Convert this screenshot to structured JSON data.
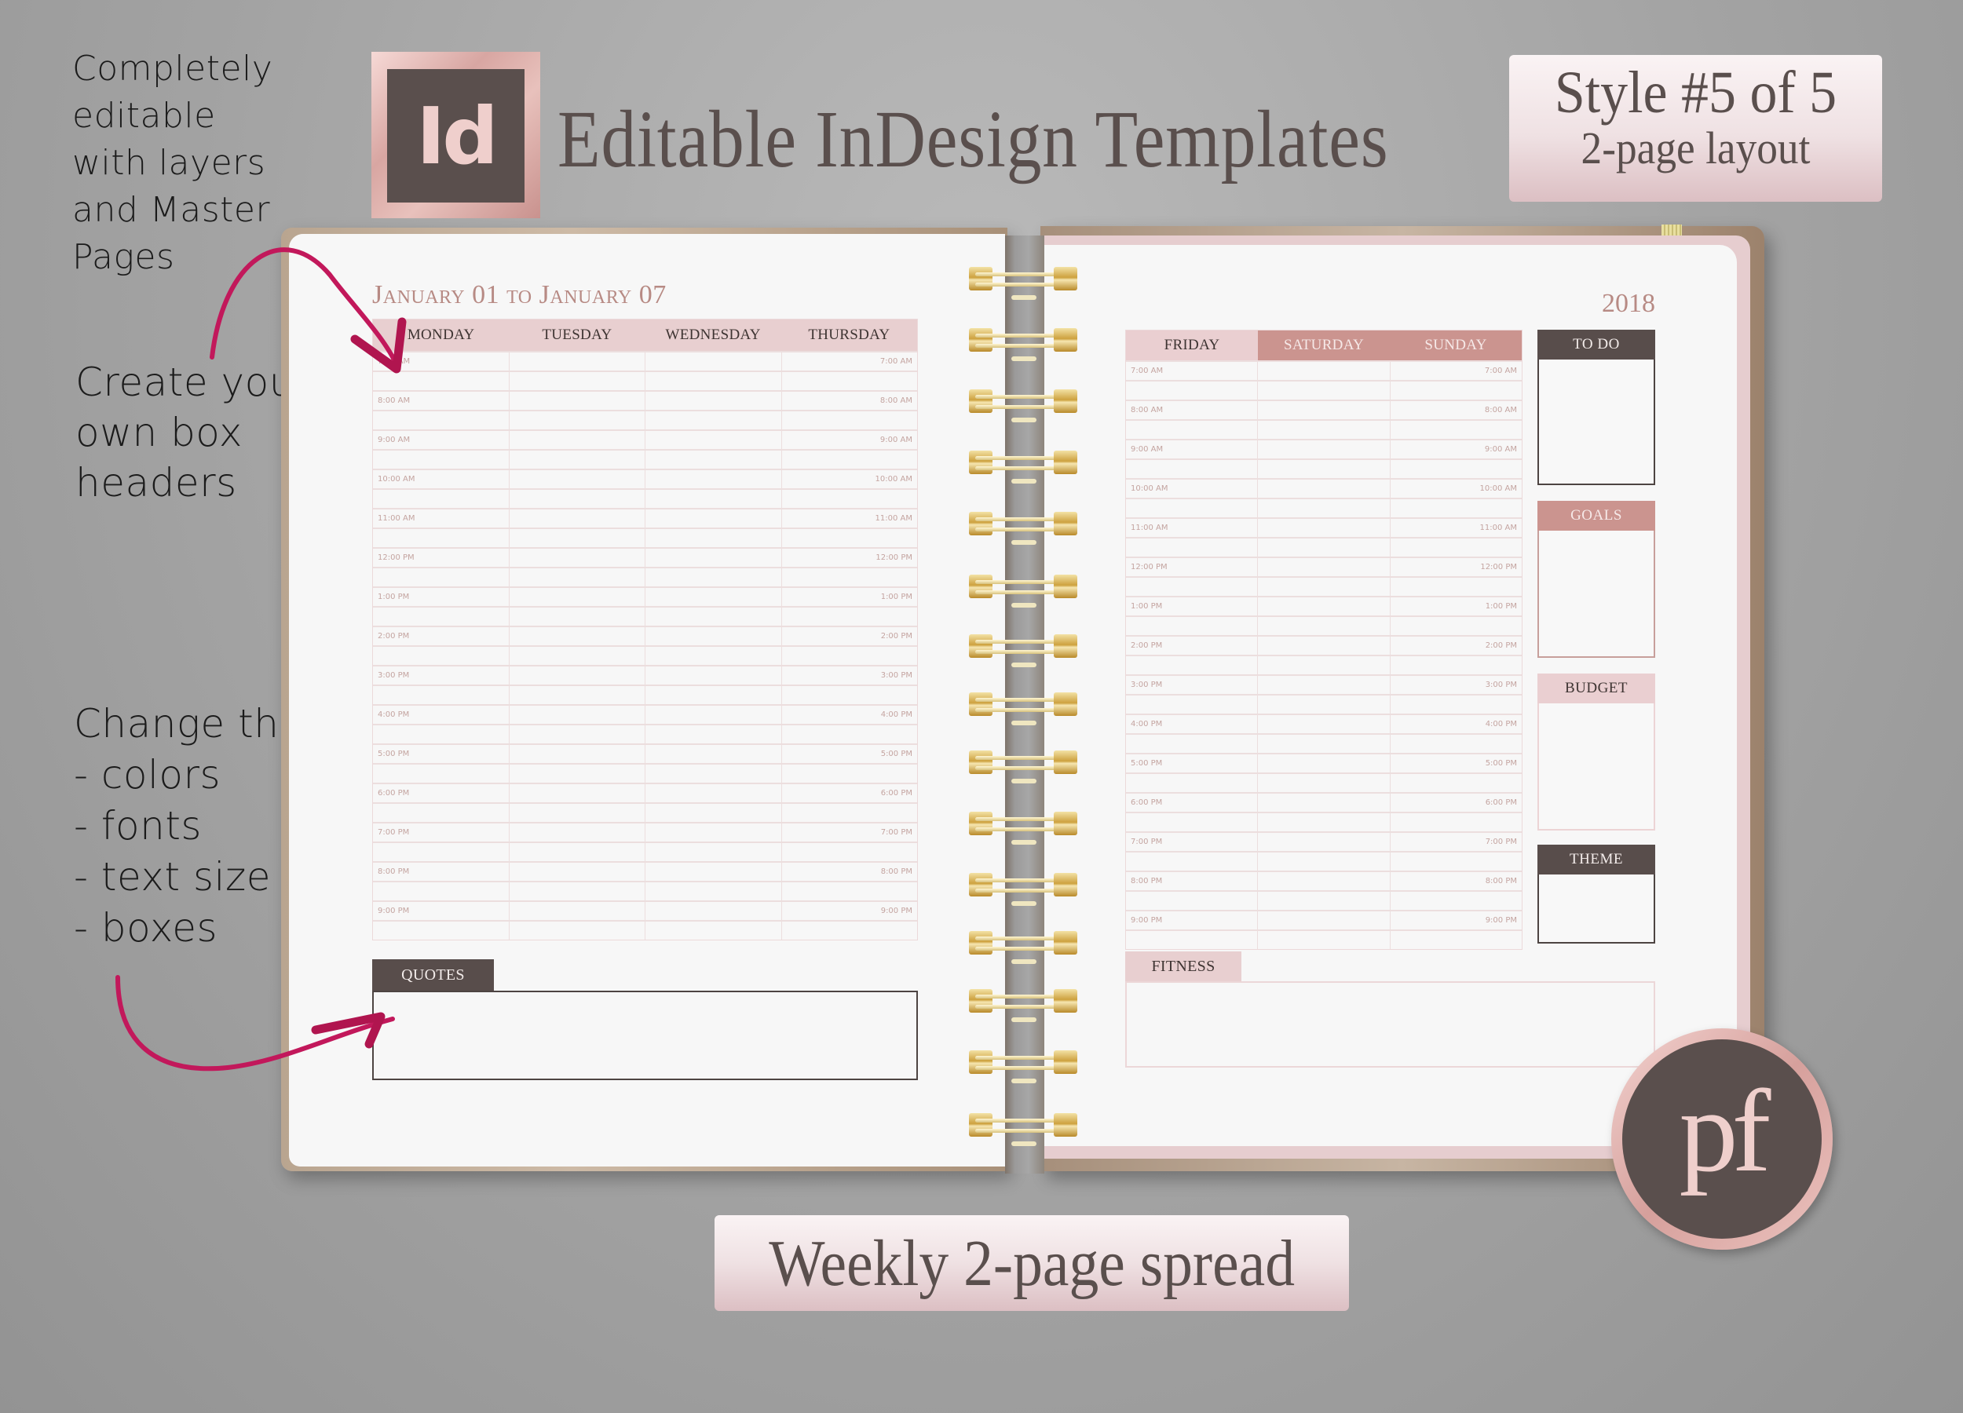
{
  "annotations": {
    "editable": [
      "Completely",
      "editable",
      "with layers",
      "and Master",
      "Pages"
    ],
    "headers": [
      "Create your",
      "own box",
      "headers"
    ],
    "change": [
      "Change the",
      "- colors",
      "- fonts",
      "- text size",
      "- boxes"
    ]
  },
  "header": {
    "logo_text": "Id",
    "title": "Editable InDesign Templates",
    "style_line1": "Style #5 of 5",
    "style_line2": "2-page layout"
  },
  "left_page": {
    "date_range": "January 01 to January 07",
    "days": [
      "MONDAY",
      "TUESDAY",
      "WEDNESDAY",
      "THURSDAY"
    ],
    "quotes_label": "QUOTES"
  },
  "right_page": {
    "year": "2018",
    "days": [
      "FRIDAY",
      "SATURDAY",
      "SUNDAY"
    ],
    "boxes": {
      "todo": "TO DO",
      "goals": "GOALS",
      "budget": "BUDGET",
      "theme": "THEME"
    },
    "fitness_label": "FITNESS"
  },
  "times": [
    "7:00 AM",
    "8:00 AM",
    "9:00 AM",
    "10:00 AM",
    "11:00 AM",
    "12:00 PM",
    "1:00 PM",
    "2:00 PM",
    "3:00 PM",
    "4:00 PM",
    "5:00 PM",
    "6:00 PM",
    "7:00 PM",
    "8:00 PM",
    "9:00 PM"
  ],
  "footer": {
    "banner": "Weekly 2-page spread",
    "brand_logo": "pf"
  },
  "colors": {
    "rose": "#cb948f",
    "blush": "#e8cfd0",
    "taupe": "#584d4b",
    "accent_arrow": "#c2185b"
  }
}
